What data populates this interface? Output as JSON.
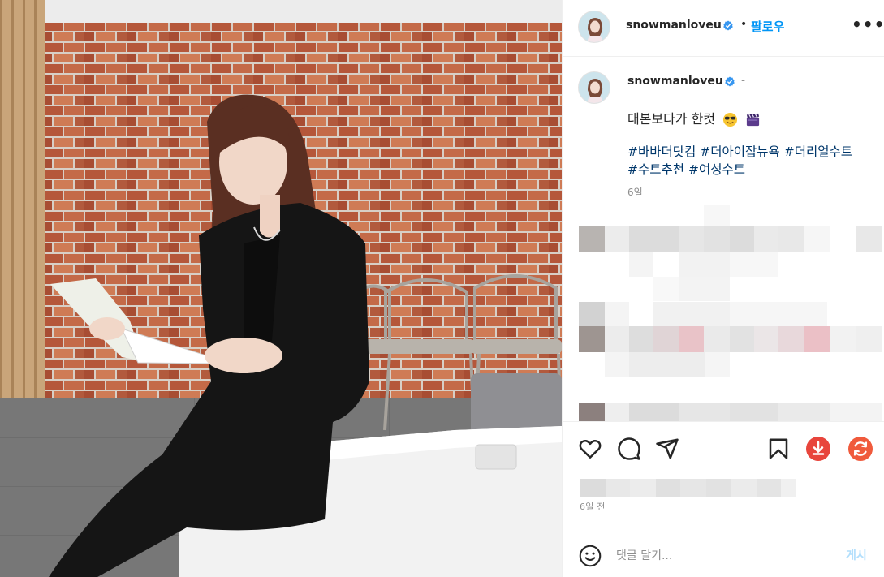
{
  "post": {
    "username": "snowmanloveu",
    "follow_label": "팔로우",
    "separator": "•",
    "more_label": "•••",
    "caption_dash": "-",
    "caption_text": "대본보다가 한컷",
    "hashtags": [
      "#바바더닷컴",
      "#더아이잡뉴욕",
      "#더리얼수트",
      "#수트추천",
      "#여성수트"
    ],
    "caption_age": "6일",
    "posted_ago": "6일 전"
  },
  "comment": {
    "placeholder": "댓글 달기...",
    "post_label": "게시"
  },
  "colors": {
    "accent": "#0095f6",
    "hashtag": "#00376b",
    "verified": "#3897f0",
    "download_badge": "#e8453c",
    "refresh_badge": "#f05a3c"
  }
}
